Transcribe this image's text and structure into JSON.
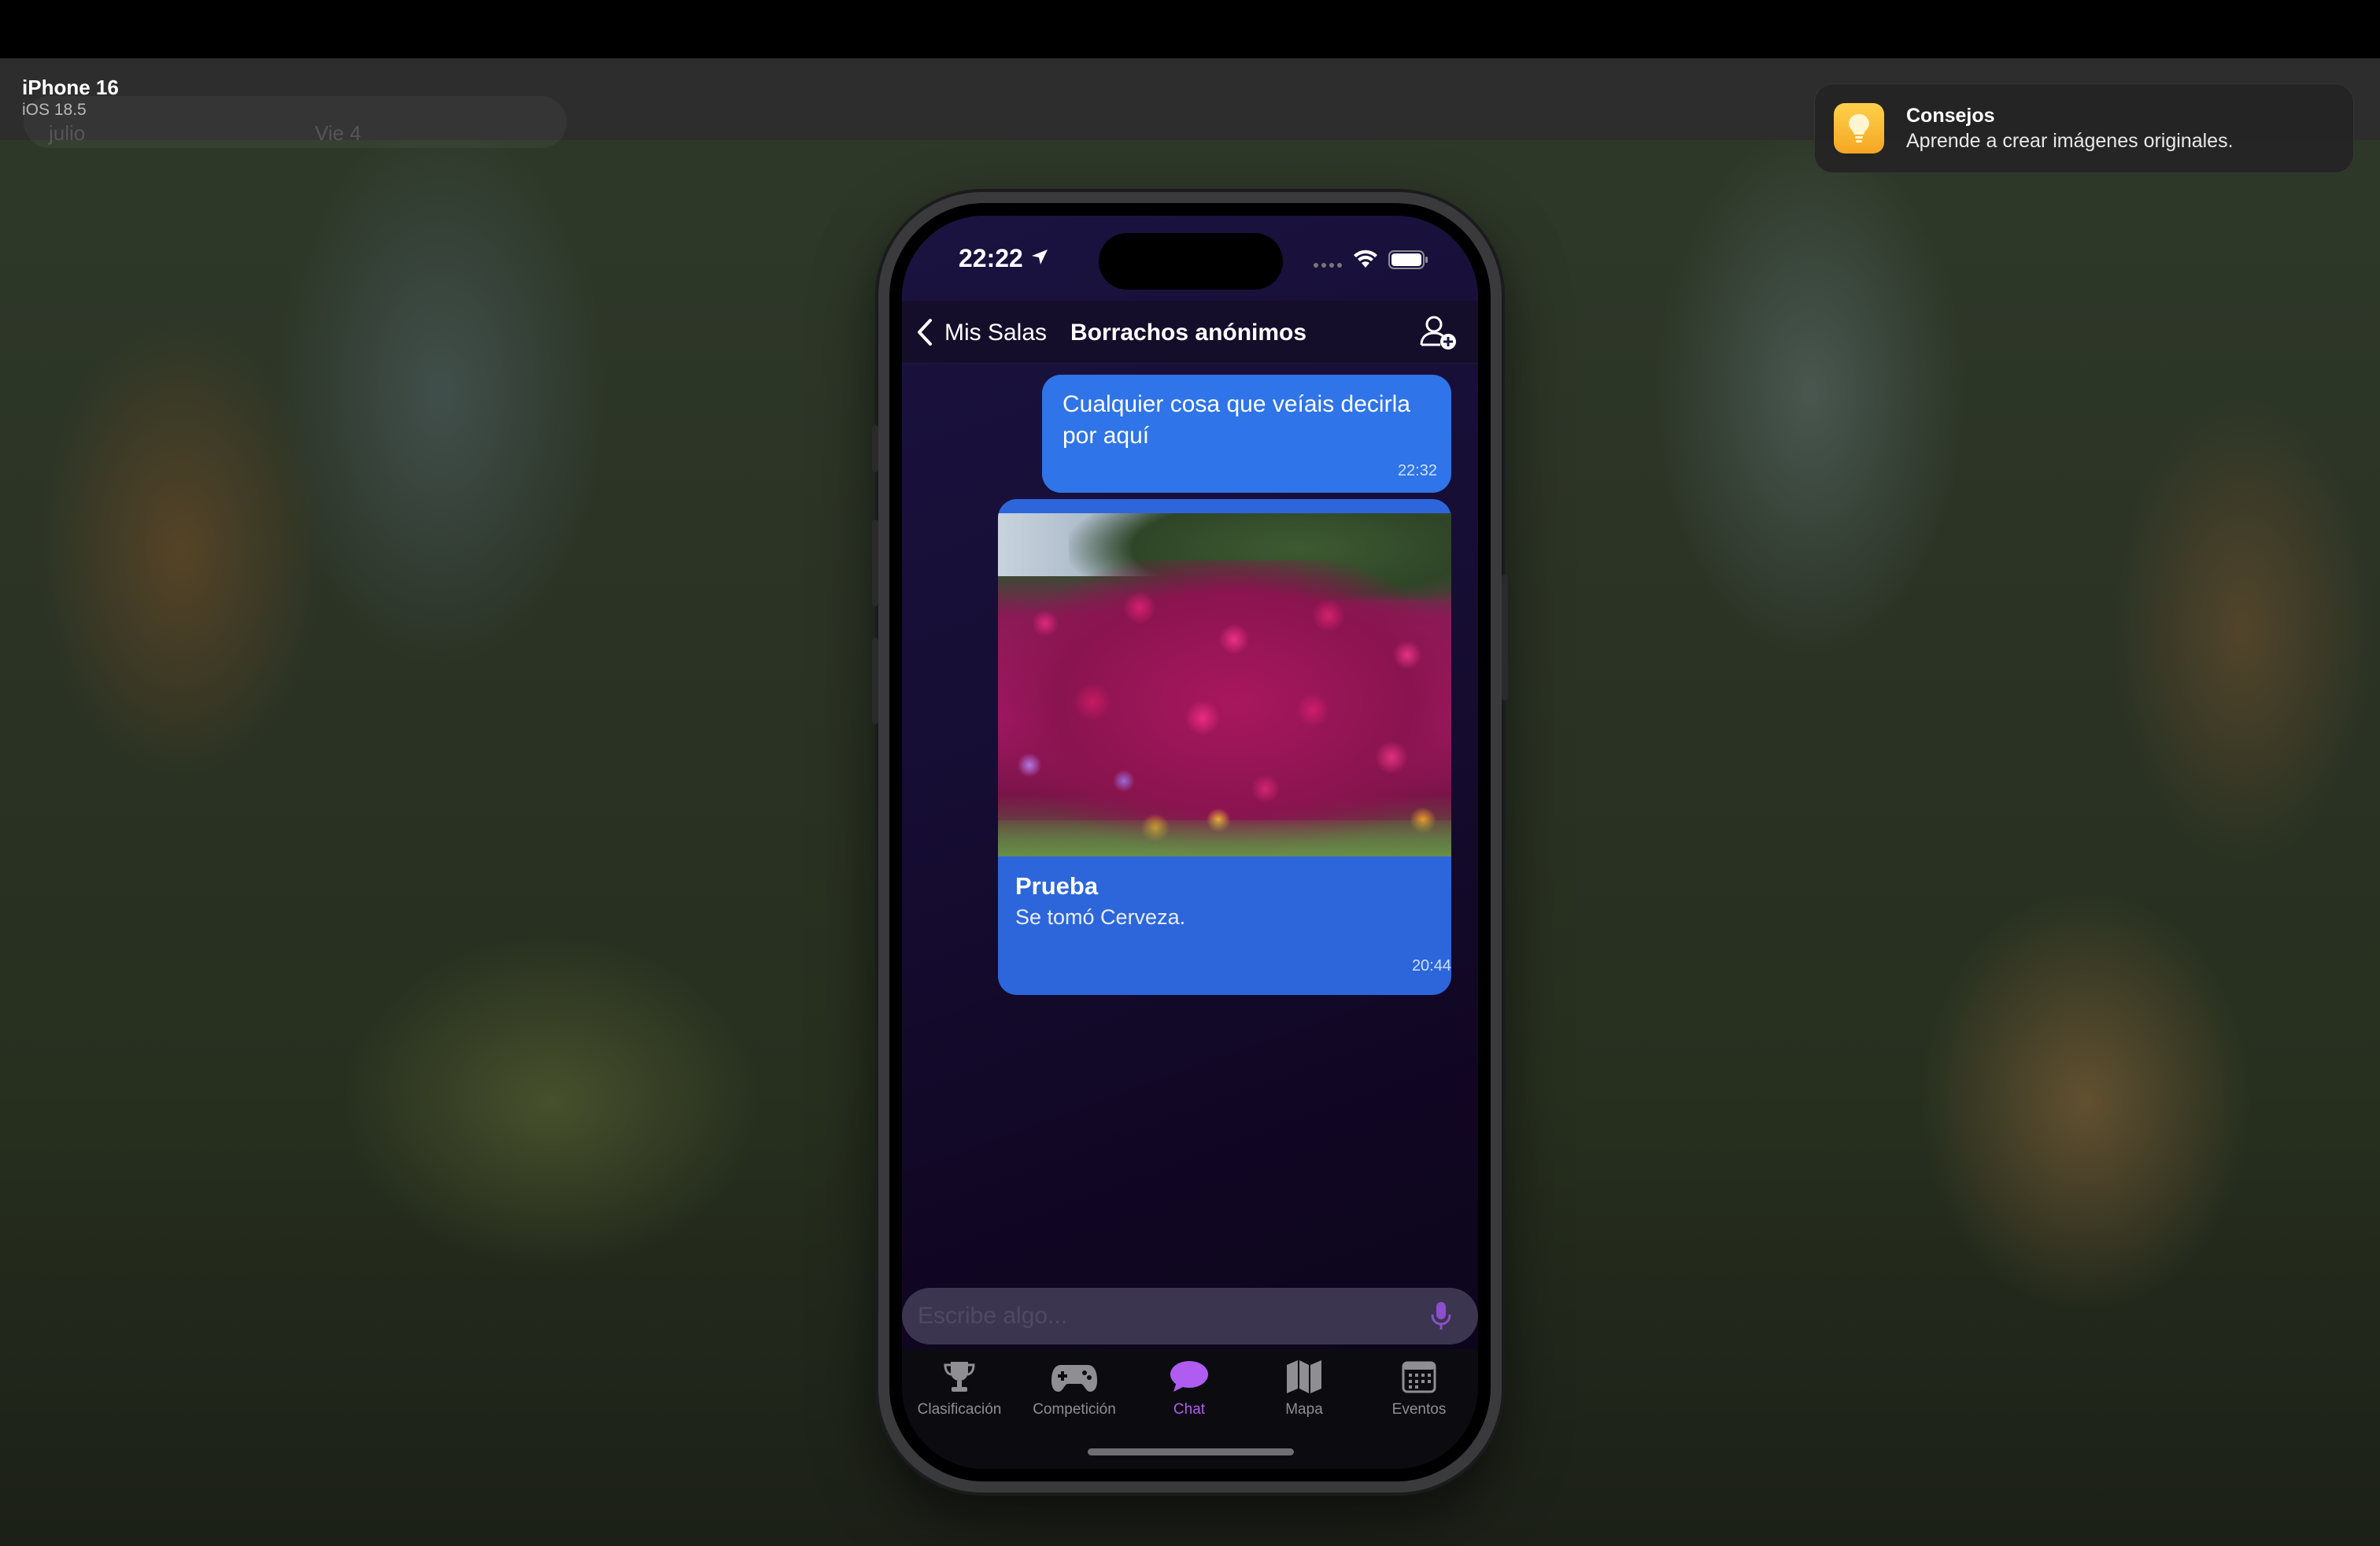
{
  "simulator": {
    "device_name": "iPhone 16",
    "os_version": "iOS 18.5",
    "ghost_text_a": "julio",
    "ghost_text_b": "Vie 4"
  },
  "notification": {
    "icon": "lightbulb-icon",
    "title": "Consejos",
    "body": "Aprende a crear imágenes originales."
  },
  "status_bar": {
    "time": "22:22",
    "icons": [
      "location-arrow-icon",
      "cellular-dots-icon",
      "wifi-icon",
      "battery-icon"
    ]
  },
  "nav": {
    "back_label": "Mis Salas",
    "title": "Borrachos anónimos",
    "action_icon": "add-user-icon"
  },
  "messages": [
    {
      "type": "text",
      "text": "Cualquier cosa que veíais decirla por aquí",
      "time": "22:32"
    },
    {
      "type": "image-card",
      "image": "pink-flowers-photo",
      "title": "Prueba",
      "text": "Se tomó Cerveza.",
      "time": "20:44"
    }
  ],
  "composer": {
    "placeholder": "Escribe algo...",
    "value": "",
    "icon": "microphone-icon"
  },
  "tabs": [
    {
      "label": "Clasificación",
      "icon": "trophy-icon",
      "active": false
    },
    {
      "label": "Competición",
      "icon": "gamecontroller-icon",
      "active": false
    },
    {
      "label": "Chat",
      "icon": "chat-bubble-icon",
      "active": true
    },
    {
      "label": "Mapa",
      "icon": "map-icon",
      "active": false
    },
    {
      "label": "Eventos",
      "icon": "calendar-icon",
      "active": false
    }
  ],
  "colors": {
    "accent": "#b05cf0",
    "bubble": "#2f74e8",
    "background": "#160d33"
  }
}
